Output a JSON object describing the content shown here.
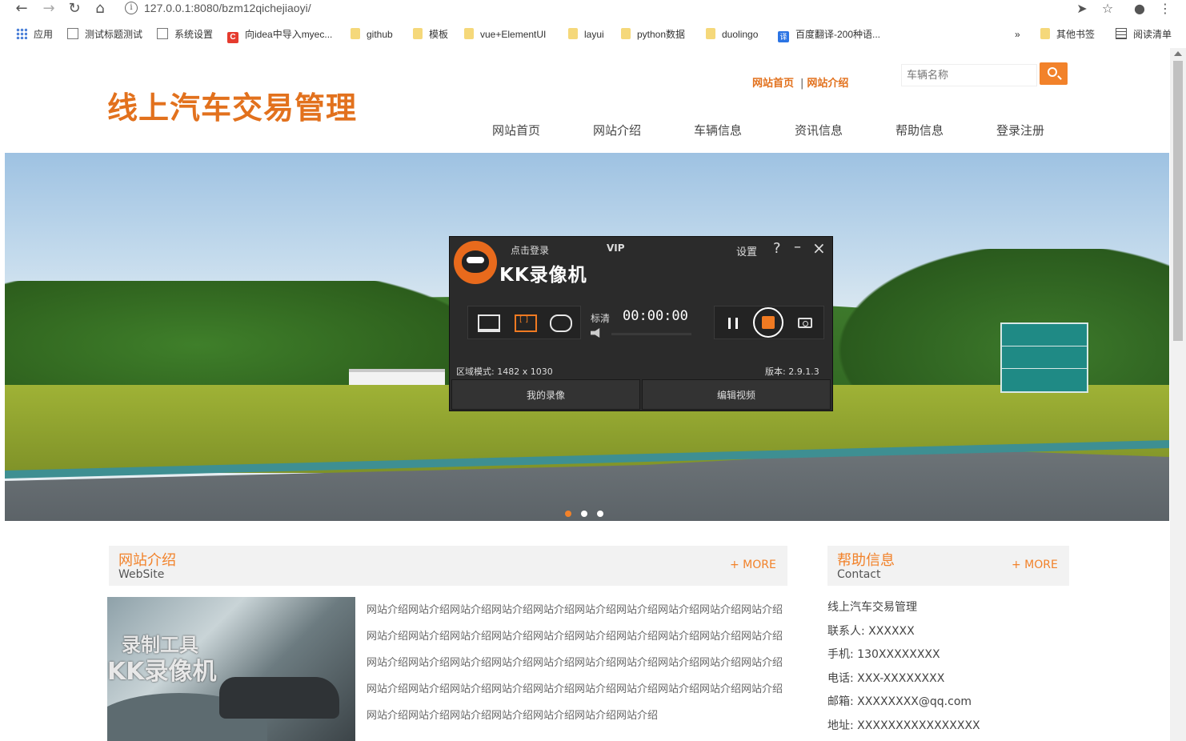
{
  "browser": {
    "url": "127.0.0.1:8080/bzm12qichejiaoyi/",
    "bookmarks": [
      "应用",
      "测试标题测试",
      "系统设置",
      "向idea中导入myec...",
      "github",
      "模板",
      "vue+ElementUI",
      "layui",
      "python数据",
      "duolingo",
      "百度翻译-200种语..."
    ],
    "bookmarks_overflow": "»",
    "other_bookmarks": "其他书签",
    "reading_list": "阅读清单"
  },
  "site": {
    "logo": "线上汽车交易管理",
    "toplinks": [
      "网站首页",
      "网站介绍"
    ],
    "toplinks_sep": "|",
    "search_placeholder": "车辆名称",
    "nav": [
      "网站首页",
      "网站介绍",
      "车辆信息",
      "资讯信息",
      "帮助信息",
      "登录注册"
    ]
  },
  "recorder": {
    "login": "点击登录",
    "vip": "VIP",
    "brand": "KK录像机",
    "settings": "设置",
    "help": "?",
    "minimize": "–",
    "close": "×",
    "quality": "标清",
    "timer": "00:00:00",
    "region_info": "区域模式: 1482 x 1030",
    "version": "版本: 2.9.1.3",
    "my_recordings": "我的录像",
    "edit_video": "编辑视频"
  },
  "about": {
    "title": "网站介绍",
    "subtitle": "WebSite",
    "more": "+ MORE",
    "image_text_1": "录制工具",
    "image_text_2": "KK录像机",
    "text": "网站介绍网站介绍网站介绍网站介绍网站介绍网站介绍网站介绍网站介绍网站介绍网站介绍网站介绍网站介绍网站介绍网站介绍网站介绍网站介绍网站介绍网站介绍网站介绍网站介绍网站介绍网站介绍网站介绍网站介绍网站介绍网站介绍网站介绍网站介绍网站介绍网站介绍网站介绍网站介绍网站介绍网站介绍网站介绍网站介绍网站介绍网站介绍网站介绍网站介绍网站介绍网站介绍网站介绍网站介绍网站介绍网站介绍网站介绍"
  },
  "help": {
    "title": "帮助信息",
    "subtitle": "Contact",
    "more": "+ MORE",
    "lines": [
      "线上汽车交易管理",
      "联系人: XXXXXX",
      "手机: 130XXXXXXXX",
      "电话: XXX-XXXXXXXX",
      "邮箱: XXXXXXXX@qq.com",
      "地址: XXXXXXXXXXXXXXXX"
    ]
  },
  "carousel": {
    "slide_count": 3,
    "active": 0
  }
}
